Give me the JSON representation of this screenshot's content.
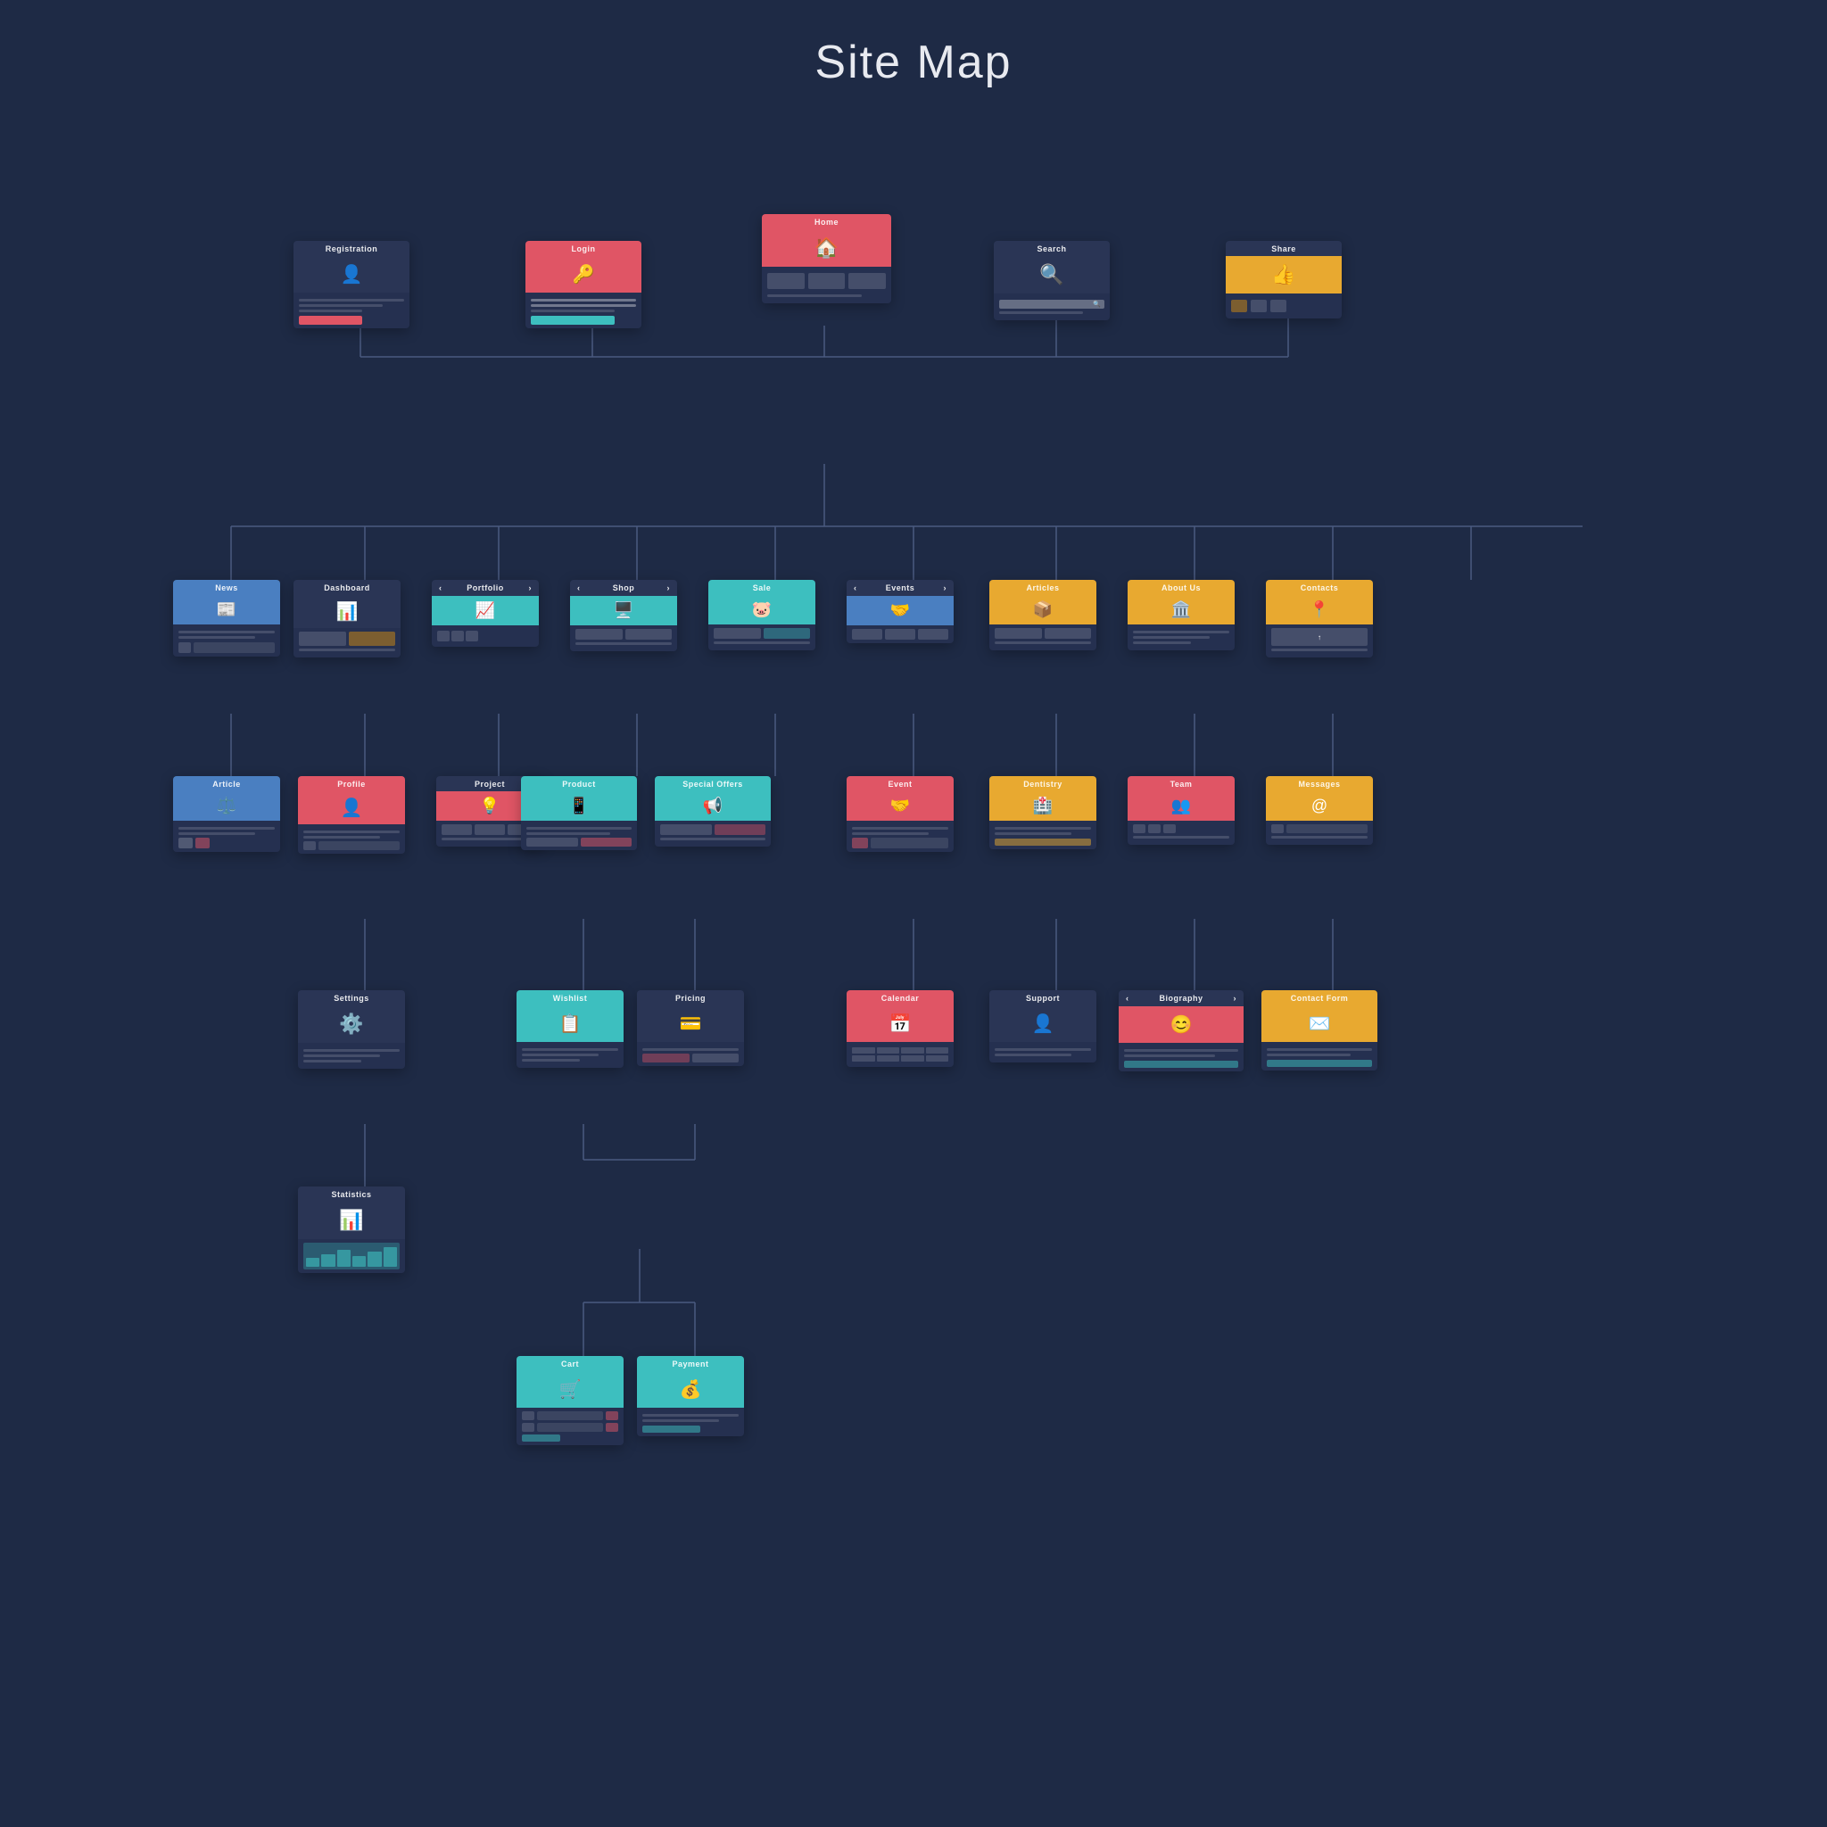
{
  "title": "Site Map",
  "colors": {
    "bg": "#1e2a45",
    "card_bg": "#253050",
    "red": "#e05565",
    "blue": "#4a7fc1",
    "teal": "#3dbfbf",
    "yellow": "#e8a930",
    "dark": "#2a3555",
    "pink": "#e05575",
    "connector": "#4a5a80"
  },
  "nodes": {
    "top_level": [
      "Registration",
      "Login",
      "Home",
      "Search",
      "Share"
    ],
    "level2": [
      "News",
      "Dashboard",
      "Portfolio",
      "Shop",
      "Sale",
      "Events",
      "Articles",
      "About Us",
      "Contacts"
    ],
    "level3": [
      "Article",
      "Profile",
      "Project",
      "Product",
      "Special Offers",
      "Event",
      "Dentistry",
      "Team",
      "Messages"
    ],
    "level4": [
      "Settings",
      "Wishlist",
      "Pricing",
      "Calendar",
      "Support",
      "Biography",
      "Contact Form"
    ],
    "level5": [
      "Statistics",
      "Cart",
      "Payment"
    ]
  }
}
